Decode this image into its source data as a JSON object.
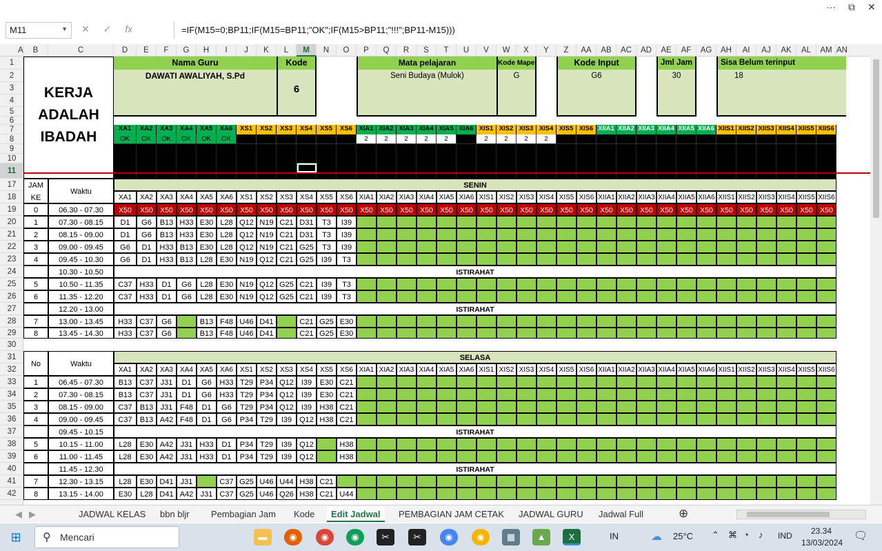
{
  "window": {
    "more": "···",
    "restore": "⧉",
    "close": "✕"
  },
  "formula_bar": {
    "name_box": "M11",
    "formula": "=IF(M15=0;BP11;IF(M15=BP11;\"OK\";IF(M15>BP11;\"!!!\";BP11-M15)))",
    "cancel": "✕",
    "enter": "✓",
    "fx": "fx"
  },
  "columns": [
    "A",
    "B",
    "C",
    "D",
    "E",
    "F",
    "G",
    "H",
    "I",
    "J",
    "K",
    "L",
    "M",
    "N",
    "O",
    "P",
    "Q",
    "R",
    "S",
    "T",
    "U",
    "V",
    "W",
    "X",
    "Y",
    "Z",
    "AA",
    "AB",
    "AC",
    "AD",
    "AE",
    "AF",
    "AG",
    "AH",
    "AI",
    "AJ",
    "AK",
    "AL",
    "AM",
    "AN"
  ],
  "selected_column": "M",
  "rows": [
    "1",
    "2",
    "3",
    "4",
    "5",
    "6",
    "7",
    "8",
    "9",
    "10",
    "11",
    "17",
    "18",
    "19",
    "20",
    "21",
    "22",
    "23",
    "24",
    "25",
    "26",
    "27",
    "28",
    "29",
    "30",
    "31",
    "32",
    "33",
    "34",
    "35",
    "36",
    "37",
    "38",
    "39",
    "40",
    "41",
    "42"
  ],
  "selected_row": "11",
  "header": {
    "motto": "KERJA ADALAH IBADAH",
    "nama_guru_label": "Nama Guru",
    "nama_guru": "DAWATI AWALIYAH, S.Pd",
    "kode_label": "Kode",
    "kode": "6",
    "mapel_label": "Mata pelajaran",
    "mapel": "Seni Budaya (Mulok)",
    "kode_mapel_label": "Kode Mapel",
    "kode_mapel": "G",
    "kode_input_label": "Kode Input",
    "kode_input": "G6",
    "jml_jam_label": "Jml Jam",
    "jml_jam": "30",
    "sisa_label": "Sisa Belum terinput",
    "sisa": "18"
  },
  "classes": [
    "XA1",
    "XA2",
    "XA3",
    "XA4",
    "XA5",
    "XA6",
    "XS1",
    "XS2",
    "XS3",
    "XS4",
    "XS5",
    "XS6",
    "XIA1",
    "XIA2",
    "XIA3",
    "XIA4",
    "XIA5",
    "XIA6",
    "XIS1",
    "XIS2",
    "XIS3",
    "XIS4",
    "XIS5",
    "XIS6",
    "XIIA1",
    "XIIA2",
    "XIIA3",
    "XIIA4",
    "XIIA5",
    "XIIA6",
    "XIIS1",
    "XIIS2",
    "XIIS3",
    "XIIS4",
    "XIIS5",
    "XIIS6"
  ],
  "status_row": [
    "OK",
    "OK",
    "OK",
    "OK",
    "OK",
    "OK",
    "",
    "",
    "",
    "",
    "",
    "",
    "2",
    "2",
    "2",
    "2",
    "2",
    "",
    "2",
    "2",
    "2",
    "2",
    "",
    "",
    "",
    "",
    "",
    "",
    "",
    "",
    "",
    "",
    "",
    "",
    "",
    ""
  ],
  "senin": {
    "day": "SENIN",
    "jam_label": "JAM KE",
    "waktu_label": "Waktu",
    "break_label": "ISTIRAHAT",
    "x50": "X50",
    "rows": [
      {
        "no": "0",
        "time": "06.30 - 07.30",
        "cells": []
      },
      {
        "no": "1",
        "time": "07.30 - 08.15",
        "cells": [
          "D1",
          "G6",
          "B13",
          "H33",
          "E30",
          "L28",
          "Q12",
          "N19",
          "C21",
          "D31",
          "T3",
          "I39"
        ]
      },
      {
        "no": "2",
        "time": "08.15 - 09.00",
        "cells": [
          "D1",
          "G6",
          "B13",
          "H33",
          "E30",
          "L28",
          "Q12",
          "N19",
          "C21",
          "D31",
          "T3",
          "I39"
        ]
      },
      {
        "no": "3",
        "time": "09.00 - 09.45",
        "cells": [
          "G6",
          "D1",
          "H33",
          "B13",
          "E30",
          "L28",
          "Q12",
          "N19",
          "C21",
          "G25",
          "T3",
          "I39"
        ]
      },
      {
        "no": "4",
        "time": "09.45 - 10.30",
        "cells": [
          "G6",
          "D1",
          "H33",
          "B13",
          "L28",
          "E30",
          "N19",
          "Q12",
          "C21",
          "G25",
          "I39",
          "T3"
        ]
      },
      {
        "no": "",
        "time": "10.30 - 10.50",
        "brk": true
      },
      {
        "no": "5",
        "time": "10.50 - 11.35",
        "cells": [
          "C37",
          "H33",
          "D1",
          "G6",
          "L28",
          "E30",
          "N19",
          "Q12",
          "G25",
          "C21",
          "I39",
          "T3"
        ]
      },
      {
        "no": "6",
        "time": "11.35 - 12.20",
        "cells": [
          "C37",
          "H33",
          "D1",
          "G6",
          "L28",
          "E30",
          "N19",
          "Q12",
          "G25",
          "C21",
          "I39",
          "T3"
        ]
      },
      {
        "no": "",
        "time": "12.20 - 13.00",
        "brk": true
      },
      {
        "no": "7",
        "time": "13.00 - 13.45",
        "cells": [
          "H33",
          "C37",
          "G6",
          "",
          "B13",
          "F48",
          "U46",
          "D41",
          "",
          "C21",
          "G25",
          "E30"
        ]
      },
      {
        "no": "8",
        "time": "13.45 - 14.30",
        "cells": [
          "H33",
          "C37",
          "G6",
          "",
          "B13",
          "F48",
          "U46",
          "D41",
          "",
          "C21",
          "G25",
          "E30"
        ]
      }
    ]
  },
  "selasa": {
    "day": "SELASA",
    "no_label": "No",
    "waktu_label": "Waktu",
    "break_label": "ISTIRAHAT",
    "rows": [
      {
        "no": "1",
        "time": "06.45 - 07.30",
        "cells": [
          "B13",
          "C37",
          "J31",
          "D1",
          "G6",
          "H33",
          "T29",
          "P34",
          "Q12",
          "I39",
          "E30",
          "C21"
        ]
      },
      {
        "no": "2",
        "time": "07.30 - 08.15",
        "cells": [
          "B13",
          "C37",
          "J31",
          "D1",
          "G6",
          "H33",
          "T29",
          "P34",
          "Q12",
          "I39",
          "E30",
          "C21"
        ]
      },
      {
        "no": "3",
        "time": "08.15 - 09.00",
        "cells": [
          "C37",
          "B13",
          "J31",
          "F48",
          "D1",
          "G6",
          "T29",
          "P34",
          "Q12",
          "I39",
          "H38",
          "C21"
        ]
      },
      {
        "no": "4",
        "time": "09.00 - 09.45",
        "cells": [
          "C37",
          "B13",
          "A42",
          "F48",
          "D1",
          "G6",
          "P34",
          "T29",
          "I39",
          "Q12",
          "H38",
          "C21"
        ]
      },
      {
        "no": "",
        "time": "09.45 - 10.15",
        "brk": true
      },
      {
        "no": "5",
        "time": "10.15 - 11.00",
        "cells": [
          "L28",
          "E30",
          "A42",
          "J31",
          "H33",
          "D1",
          "P34",
          "T29",
          "I39",
          "Q12",
          "",
          "H38"
        ]
      },
      {
        "no": "6",
        "time": "11.00 - 11.45",
        "cells": [
          "L28",
          "E30",
          "A42",
          "J31",
          "H33",
          "D1",
          "P34",
          "T29",
          "I39",
          "Q12",
          "",
          "H38"
        ]
      },
      {
        "no": "",
        "time": "11.45 - 12.30",
        "brk": true
      },
      {
        "no": "7",
        "time": "12.30 - 13.15",
        "cells": [
          "L28",
          "E30",
          "D41",
          "J31",
          "",
          "C37",
          "G25",
          "U46",
          "U44",
          "H38",
          "C21",
          ""
        ]
      },
      {
        "no": "8",
        "time": "13.15 - 14.00",
        "cells": [
          "E30",
          "L28",
          "D41",
          "A42",
          "J31",
          "C37",
          "G25",
          "U46",
          "Q26",
          "H38",
          "C21",
          "U44"
        ]
      }
    ]
  },
  "sheet_tabs": [
    "JADWAL KELAS",
    "bbn bljr",
    "Pembagian Jam",
    "Kode",
    "Edit Jadwal",
    "PEMBAGIAN JAM CETAK",
    "JADWAL GURU",
    "Jadwal Full"
  ],
  "active_tab": "Edit Jadwal",
  "taskbar": {
    "search": "Mencari",
    "lang": "IN",
    "temp": "25°C",
    "ime": "IND",
    "time": "23.34",
    "date": "13/03/2024"
  },
  "colors": {
    "green_light": "#d8e4bc",
    "green_bright": "#92d050",
    "orange": "#ffc000",
    "red": "#c00000",
    "black": "#000000",
    "ok_green": "#00b050"
  }
}
